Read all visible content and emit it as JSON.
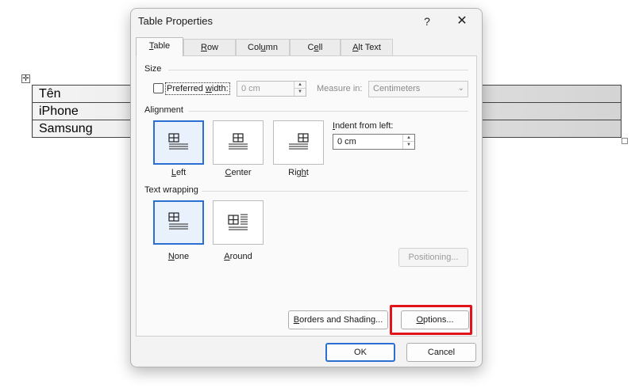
{
  "document": {
    "move_handle_icon": "four-way-arrow-icon",
    "rows": [
      "Tên",
      "iPhone",
      "Samsung"
    ]
  },
  "dialog": {
    "title": "Table Properties",
    "help": "?",
    "close": "✕",
    "tabs": [
      {
        "pre": "",
        "key": "T",
        "post": "able",
        "active": true
      },
      {
        "pre": "",
        "key": "R",
        "post": "ow",
        "active": false
      },
      {
        "pre": "Col",
        "key": "u",
        "post": "mn",
        "active": false
      },
      {
        "pre": "C",
        "key": "e",
        "post": "ll",
        "active": false
      },
      {
        "pre": "",
        "key": "A",
        "post": "lt Text",
        "active": false
      }
    ],
    "size": {
      "group": "Size",
      "preferred_width_pre": "Preferred ",
      "preferred_width_key": "w",
      "preferred_width_post": "idth:",
      "preferred_width_checked": false,
      "width_value": "0 cm",
      "measure_in_label": "Measure in:",
      "measure_in_value": "Centimeters"
    },
    "alignment": {
      "group": "Alignment",
      "options": [
        {
          "pre": "",
          "key": "L",
          "post": "eft",
          "selected": true
        },
        {
          "pre": "",
          "key": "C",
          "post": "enter",
          "selected": false
        },
        {
          "pre": "Rig",
          "key": "h",
          "post": "t",
          "selected": false
        }
      ],
      "indent_pre": "",
      "indent_key": "I",
      "indent_post": "ndent from left:",
      "indent_value": "0 cm"
    },
    "wrapping": {
      "group": "Text wrapping",
      "options": [
        {
          "pre": "",
          "key": "N",
          "post": "one",
          "selected": true
        },
        {
          "pre": "",
          "key": "A",
          "post": "round",
          "selected": false
        }
      ],
      "positioning": "Positioning..."
    },
    "buttons": {
      "borders_pre": "",
      "borders_key": "B",
      "borders_post": "orders and Shading...",
      "options_pre": "",
      "options_key": "O",
      "options_post": "ptions...",
      "ok": "OK",
      "cancel": "Cancel"
    },
    "colors": {
      "accent": "#2a6fd1",
      "highlight": "#e3131b"
    }
  }
}
